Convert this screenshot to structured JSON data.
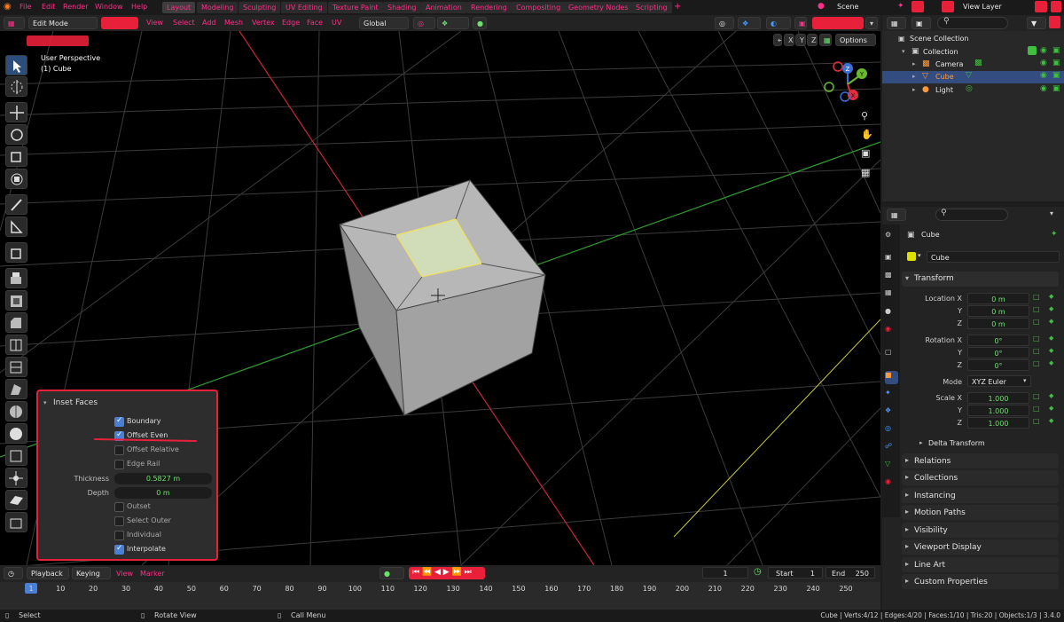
{
  "topbar": {
    "menus": [
      "File",
      "Edit",
      "Render",
      "Window",
      "Help"
    ],
    "workspaces": [
      "Layout",
      "Modeling",
      "Sculpting",
      "UV Editing",
      "Texture Paint",
      "Shading",
      "Animation",
      "Rendering",
      "Compositing",
      "Geometry Nodes",
      "Scripting"
    ],
    "add_tab": "+",
    "scene": "Scene",
    "view_layer": "View Layer"
  },
  "header": {
    "mode": "Edit Mode",
    "menus": [
      "View",
      "Select",
      "Add",
      "Mesh",
      "Vertex",
      "Edge",
      "Face",
      "UV"
    ],
    "orientation": "Global",
    "axes": [
      "X",
      "Y",
      "Z"
    ],
    "options": "Options"
  },
  "viewport": {
    "perspective": "User Perspective",
    "object": "(1) Cube",
    "gizmo_labels": [
      "Y",
      "Z",
      "X"
    ]
  },
  "operator_panel": {
    "title": "Inset Faces",
    "boundary": "Boundary",
    "offset_even": "Offset Even",
    "offset_relative": "Offset Relative",
    "edge_rail": "Edge Rail",
    "thickness_label": "Thickness",
    "thickness_value": "0.5827 m",
    "depth_label": "Depth",
    "depth_value": "0 m",
    "outset": "Outset",
    "select_outer": "Select Outer",
    "individual": "Individual",
    "interpolate": "Interpolate",
    "checked": {
      "boundary": true,
      "offset_even": true,
      "offset_relative": false,
      "edge_rail": false,
      "outset": false,
      "select_outer": false,
      "individual": false,
      "interpolate": true
    }
  },
  "outliner": {
    "scene_collection": "Scene Collection",
    "collection": "Collection",
    "items": [
      "Camera",
      "Cube",
      "Light"
    ]
  },
  "properties": {
    "object_name": "Cube",
    "data_name": "Cube",
    "transform": "Transform",
    "location_label": "Location X",
    "location": [
      "0 m",
      "0 m",
      "0 m"
    ],
    "rotation_label": "Rotation X",
    "rotation": [
      "0°",
      "0°",
      "0°"
    ],
    "mode_label": "Mode",
    "mode": "XYZ Euler",
    "scale_label": "Scale X",
    "scale": [
      "1.000",
      "1.000",
      "1.000"
    ],
    "y": "Y",
    "z": "Z",
    "delta": "Delta Transform",
    "sections": [
      "Relations",
      "Collections",
      "Instancing",
      "Motion Paths",
      "Visibility",
      "Viewport Display",
      "Line Art",
      "Custom Properties"
    ]
  },
  "timeline": {
    "playback": "Playback",
    "keying": "Keying",
    "view": "View",
    "marker": "Marker",
    "current_frame": "1",
    "start_label": "Start",
    "start": "1",
    "end_label": "End",
    "end": "250",
    "ticks": [
      "1",
      "10",
      "20",
      "30",
      "40",
      "50",
      "60",
      "70",
      "80",
      "90",
      "100",
      "110",
      "120",
      "130",
      "140",
      "150",
      "160",
      "170",
      "180",
      "190",
      "200",
      "210",
      "220",
      "230",
      "240",
      "250"
    ]
  },
  "status": {
    "select": "Select",
    "rotate": "Rotate View",
    "call_menu": "Call Menu",
    "stats": "Cube | Verts:4/12 | Edges:4/20 | Faces:1/10 | Tris:20 | Objects:1/3 | 3.4.0"
  },
  "colors": {
    "accent": "#ff2e88",
    "highlight": "#e8203a",
    "value_green": "#6be36b",
    "select_blue": "#4a7fd4"
  }
}
